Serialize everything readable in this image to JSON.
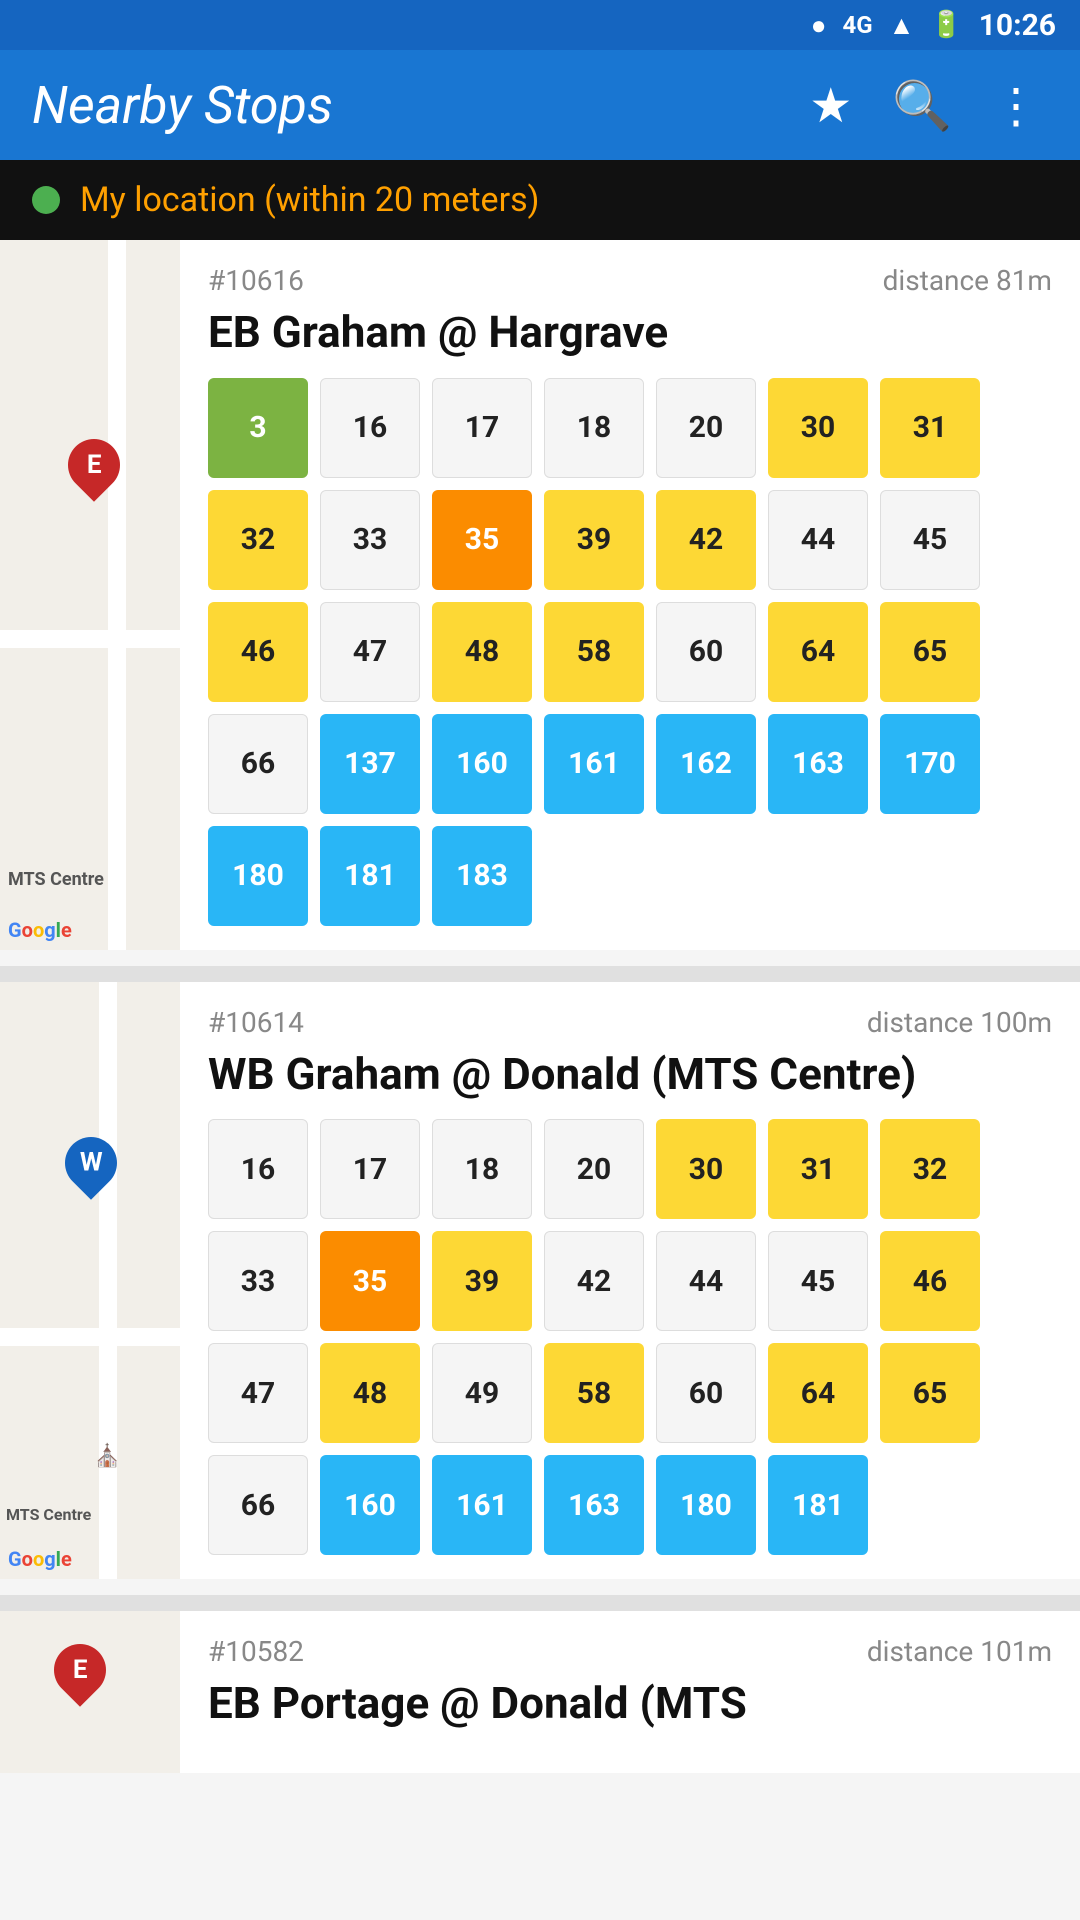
{
  "statusBar": {
    "time": "10:26"
  },
  "appBar": {
    "title": "Nearby Stops",
    "starIcon": "★",
    "searchIcon": "🔍",
    "moreIcon": "⋮"
  },
  "locationBar": {
    "text": "My location (within 20 meters)"
  },
  "stops": [
    {
      "id": "#10616",
      "distance": "distance 81m",
      "name": "EB Graham @ Hargrave",
      "routes": [
        {
          "label": "3",
          "color": "chip-green"
        },
        {
          "label": "16",
          "color": "chip-white"
        },
        {
          "label": "17",
          "color": "chip-white"
        },
        {
          "label": "18",
          "color": "chip-white"
        },
        {
          "label": "20",
          "color": "chip-white"
        },
        {
          "label": "30",
          "color": "chip-yellow"
        },
        {
          "label": "31",
          "color": "chip-yellow"
        },
        {
          "label": "32",
          "color": "chip-yellow"
        },
        {
          "label": "33",
          "color": "chip-white"
        },
        {
          "label": "35",
          "color": "chip-orange"
        },
        {
          "label": "39",
          "color": "chip-yellow"
        },
        {
          "label": "42",
          "color": "chip-yellow"
        },
        {
          "label": "44",
          "color": "chip-white"
        },
        {
          "label": "45",
          "color": "chip-white"
        },
        {
          "label": "46",
          "color": "chip-yellow"
        },
        {
          "label": "47",
          "color": "chip-white"
        },
        {
          "label": "48",
          "color": "chip-yellow"
        },
        {
          "label": "58",
          "color": "chip-yellow"
        },
        {
          "label": "60",
          "color": "chip-white"
        },
        {
          "label": "64",
          "color": "chip-yellow"
        },
        {
          "label": "65",
          "color": "chip-yellow"
        },
        {
          "label": "66",
          "color": "chip-white"
        },
        {
          "label": "137",
          "color": "chip-blue"
        },
        {
          "label": "160",
          "color": "chip-blue"
        },
        {
          "label": "161",
          "color": "chip-blue"
        },
        {
          "label": "162",
          "color": "chip-blue"
        },
        {
          "label": "163",
          "color": "chip-blue"
        },
        {
          "label": "170",
          "color": "chip-blue"
        },
        {
          "label": "180",
          "color": "chip-blue"
        },
        {
          "label": "181",
          "color": "chip-blue"
        },
        {
          "label": "183",
          "color": "chip-blue"
        }
      ],
      "mapPin": "red",
      "mapLabel": "E"
    },
    {
      "id": "#10614",
      "distance": "distance 100m",
      "name": "WB Graham @ Donald (MTS Centre)",
      "routes": [
        {
          "label": "16",
          "color": "chip-white"
        },
        {
          "label": "17",
          "color": "chip-white"
        },
        {
          "label": "18",
          "color": "chip-white"
        },
        {
          "label": "20",
          "color": "chip-white"
        },
        {
          "label": "30",
          "color": "chip-yellow"
        },
        {
          "label": "31",
          "color": "chip-yellow"
        },
        {
          "label": "32",
          "color": "chip-yellow"
        },
        {
          "label": "33",
          "color": "chip-white"
        },
        {
          "label": "35",
          "color": "chip-orange"
        },
        {
          "label": "39",
          "color": "chip-yellow"
        },
        {
          "label": "42",
          "color": "chip-white"
        },
        {
          "label": "44",
          "color": "chip-white"
        },
        {
          "label": "45",
          "color": "chip-white"
        },
        {
          "label": "46",
          "color": "chip-yellow"
        },
        {
          "label": "47",
          "color": "chip-white"
        },
        {
          "label": "48",
          "color": "chip-yellow"
        },
        {
          "label": "49",
          "color": "chip-white"
        },
        {
          "label": "58",
          "color": "chip-yellow"
        },
        {
          "label": "60",
          "color": "chip-white"
        },
        {
          "label": "64",
          "color": "chip-yellow"
        },
        {
          "label": "65",
          "color": "chip-yellow"
        },
        {
          "label": "66",
          "color": "chip-white"
        },
        {
          "label": "160",
          "color": "chip-blue"
        },
        {
          "label": "161",
          "color": "chip-blue"
        },
        {
          "label": "163",
          "color": "chip-blue"
        },
        {
          "label": "180",
          "color": "chip-blue"
        },
        {
          "label": "181",
          "color": "chip-blue"
        }
      ],
      "mapPin": "blue",
      "mapLabel": "W"
    },
    {
      "id": "#10582",
      "distance": "distance 101m",
      "name": "EB Portage @ Donald (MTS",
      "routes": [],
      "mapPin": "red",
      "mapLabel": "E"
    }
  ]
}
